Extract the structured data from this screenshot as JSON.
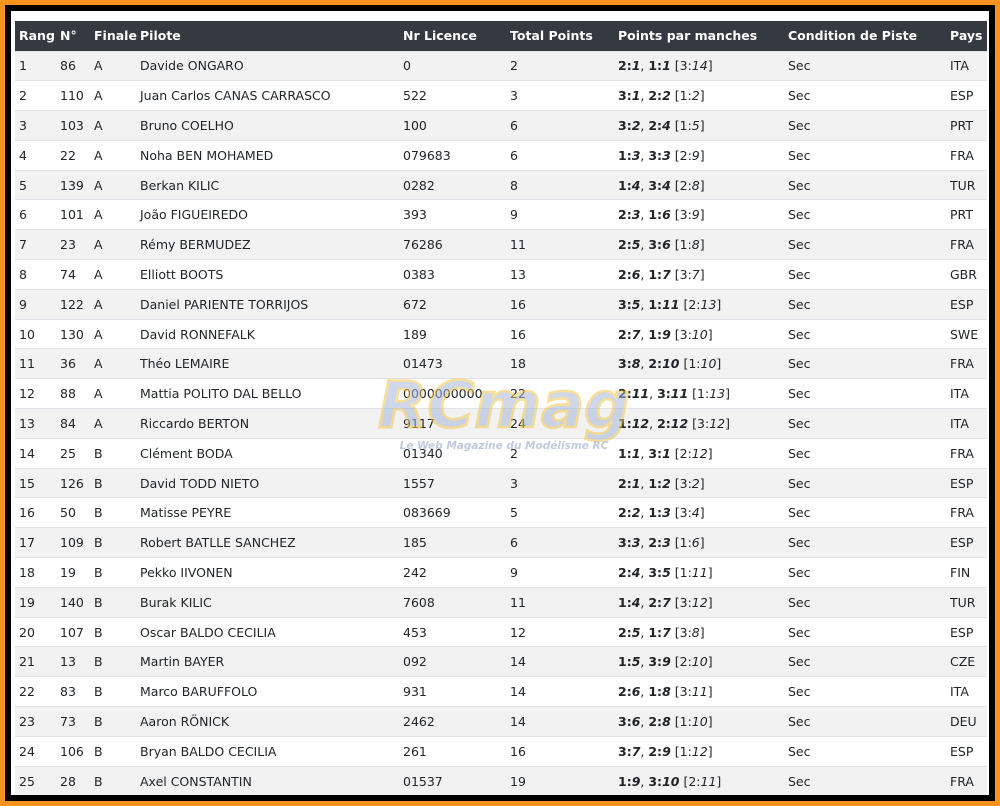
{
  "headers": [
    "Rang",
    "N°",
    "Finale",
    "Pilote",
    "Nr Licence",
    "Total Points",
    "Points par manches",
    "Condition de Piste",
    "Pays"
  ],
  "rows": [
    {
      "rang": "1",
      "num": "86",
      "finale": "A",
      "pilote": "Davide ONGARO",
      "licence": "0",
      "total": "2",
      "m1": "2:1",
      "m2": "1:1",
      "m3a": "3",
      "m3b": "14",
      "cond": "Sec",
      "pays": "ITA"
    },
    {
      "rang": "2",
      "num": "110",
      "finale": "A",
      "pilote": "Juan Carlos CANAS CARRASCO",
      "licence": "522",
      "total": "3",
      "m1": "3:1",
      "m2": "2:2",
      "m3a": "1",
      "m3b": "2",
      "cond": "Sec",
      "pays": "ESP"
    },
    {
      "rang": "3",
      "num": "103",
      "finale": "A",
      "pilote": "Bruno COELHO",
      "licence": "100",
      "total": "6",
      "m1": "3:2",
      "m2": "2:4",
      "m3a": "1",
      "m3b": "5",
      "cond": "Sec",
      "pays": "PRT"
    },
    {
      "rang": "4",
      "num": "22",
      "finale": "A",
      "pilote": "Noha BEN MOHAMED",
      "licence": "079683",
      "total": "6",
      "m1": "1:3",
      "m2": "3:3",
      "m3a": "2",
      "m3b": "9",
      "cond": "Sec",
      "pays": "FRA"
    },
    {
      "rang": "5",
      "num": "139",
      "finale": "A",
      "pilote": "Berkan KILIC",
      "licence": "0282",
      "total": "8",
      "m1": "1:4",
      "m2": "3:4",
      "m3a": "2",
      "m3b": "8",
      "cond": "Sec",
      "pays": "TUR"
    },
    {
      "rang": "6",
      "num": "101",
      "finale": "A",
      "pilote": "João FIGUEIREDO",
      "licence": "393",
      "total": "9",
      "m1": "2:3",
      "m2": "1:6",
      "m3a": "3",
      "m3b": "9",
      "cond": "Sec",
      "pays": "PRT"
    },
    {
      "rang": "7",
      "num": "23",
      "finale": "A",
      "pilote": "Rémy BERMUDEZ",
      "licence": "76286",
      "total": "11",
      "m1": "2:5",
      "m2": "3:6",
      "m3a": "1",
      "m3b": "8",
      "cond": "Sec",
      "pays": "FRA"
    },
    {
      "rang": "8",
      "num": "74",
      "finale": "A",
      "pilote": "Elliott BOOTS",
      "licence": "0383",
      "total": "13",
      "m1": "2:6",
      "m2": "1:7",
      "m3a": "3",
      "m3b": "7",
      "cond": "Sec",
      "pays": "GBR"
    },
    {
      "rang": "9",
      "num": "122",
      "finale": "A",
      "pilote": "Daniel PARIENTE TORRIJOS",
      "licence": "672",
      "total": "16",
      "m1": "3:5",
      "m2": "1:11",
      "m3a": "2",
      "m3b": "13",
      "cond": "Sec",
      "pays": "ESP"
    },
    {
      "rang": "10",
      "num": "130",
      "finale": "A",
      "pilote": "David RONNEFALK",
      "licence": "189",
      "total": "16",
      "m1": "2:7",
      "m2": "1:9",
      "m3a": "3",
      "m3b": "10",
      "cond": "Sec",
      "pays": "SWE"
    },
    {
      "rang": "11",
      "num": "36",
      "finale": "A",
      "pilote": "Théo LEMAIRE",
      "licence": "01473",
      "total": "18",
      "m1": "3:8",
      "m2": "2:10",
      "m3a": "1",
      "m3b": "10",
      "cond": "Sec",
      "pays": "FRA"
    },
    {
      "rang": "12",
      "num": "88",
      "finale": "A",
      "pilote": "Mattia POLITO DAL BELLO",
      "licence": "0000000000",
      "total": "22",
      "m1": "2:11",
      "m2": "3:11",
      "m3a": "1",
      "m3b": "13",
      "cond": "Sec",
      "pays": "ITA"
    },
    {
      "rang": "13",
      "num": "84",
      "finale": "A",
      "pilote": "Riccardo BERTON",
      "licence": "9117",
      "total": "24",
      "m1": "1:12",
      "m2": "2:12",
      "m3a": "3",
      "m3b": "12",
      "cond": "Sec",
      "pays": "ITA"
    },
    {
      "rang": "14",
      "num": "25",
      "finale": "B",
      "pilote": "Clément BODA",
      "licence": "01340",
      "total": "2",
      "m1": "1:1",
      "m2": "3:1",
      "m3a": "2",
      "m3b": "12",
      "cond": "Sec",
      "pays": "FRA"
    },
    {
      "rang": "15",
      "num": "126",
      "finale": "B",
      "pilote": "David TODD NIETO",
      "licence": "1557",
      "total": "3",
      "m1": "2:1",
      "m2": "1:2",
      "m3a": "3",
      "m3b": "2",
      "cond": "Sec",
      "pays": "ESP"
    },
    {
      "rang": "16",
      "num": "50",
      "finale": "B",
      "pilote": "Matisse PEYRE",
      "licence": "083669",
      "total": "5",
      "m1": "2:2",
      "m2": "1:3",
      "m3a": "3",
      "m3b": "4",
      "cond": "Sec",
      "pays": "FRA"
    },
    {
      "rang": "17",
      "num": "109",
      "finale": "B",
      "pilote": "Robert BATLLE SANCHEZ",
      "licence": "185",
      "total": "6",
      "m1": "3:3",
      "m2": "2:3",
      "m3a": "1",
      "m3b": "6",
      "cond": "Sec",
      "pays": "ESP"
    },
    {
      "rang": "18",
      "num": "19",
      "finale": "B",
      "pilote": "Pekko IIVONEN",
      "licence": "242",
      "total": "9",
      "m1": "2:4",
      "m2": "3:5",
      "m3a": "1",
      "m3b": "11",
      "cond": "Sec",
      "pays": "FIN"
    },
    {
      "rang": "19",
      "num": "140",
      "finale": "B",
      "pilote": "Burak KILIC",
      "licence": "7608",
      "total": "11",
      "m1": "1:4",
      "m2": "2:7",
      "m3a": "3",
      "m3b": "12",
      "cond": "Sec",
      "pays": "TUR"
    },
    {
      "rang": "20",
      "num": "107",
      "finale": "B",
      "pilote": "Oscar BALDO CECILIA",
      "licence": "453",
      "total": "12",
      "m1": "2:5",
      "m2": "1:7",
      "m3a": "3",
      "m3b": "8",
      "cond": "Sec",
      "pays": "ESP"
    },
    {
      "rang": "21",
      "num": "13",
      "finale": "B",
      "pilote": "Martin BAYER",
      "licence": "092",
      "total": "14",
      "m1": "1:5",
      "m2": "3:9",
      "m3a": "2",
      "m3b": "10",
      "cond": "Sec",
      "pays": "CZE"
    },
    {
      "rang": "22",
      "num": "83",
      "finale": "B",
      "pilote": "Marco BARUFFOLO",
      "licence": "931",
      "total": "14",
      "m1": "2:6",
      "m2": "1:8",
      "m3a": "3",
      "m3b": "11",
      "cond": "Sec",
      "pays": "ITA"
    },
    {
      "rang": "23",
      "num": "73",
      "finale": "B",
      "pilote": "Aaron RÖNICK",
      "licence": "2462",
      "total": "14",
      "m1": "3:6",
      "m2": "2:8",
      "m3a": "1",
      "m3b": "10",
      "cond": "Sec",
      "pays": "DEU"
    },
    {
      "rang": "24",
      "num": "106",
      "finale": "B",
      "pilote": "Bryan BALDO CECILIA",
      "licence": "261",
      "total": "16",
      "m1": "3:7",
      "m2": "2:9",
      "m3a": "1",
      "m3b": "12",
      "cond": "Sec",
      "pays": "ESP"
    },
    {
      "rang": "25",
      "num": "28",
      "finale": "B",
      "pilote": "Axel CONSTANTIN",
      "licence": "01537",
      "total": "19",
      "m1": "1:9",
      "m2": "3:10",
      "m3a": "2",
      "m3b": "11",
      "cond": "Sec",
      "pays": "FRA"
    }
  ],
  "watermark": {
    "brand": "RCmag",
    "tagline": "Le Web Magazine du Modélisme RC"
  },
  "colors": {
    "frame": "#f7931e",
    "header_bg": "#343a40",
    "stripe": "#f2f2f2"
  }
}
